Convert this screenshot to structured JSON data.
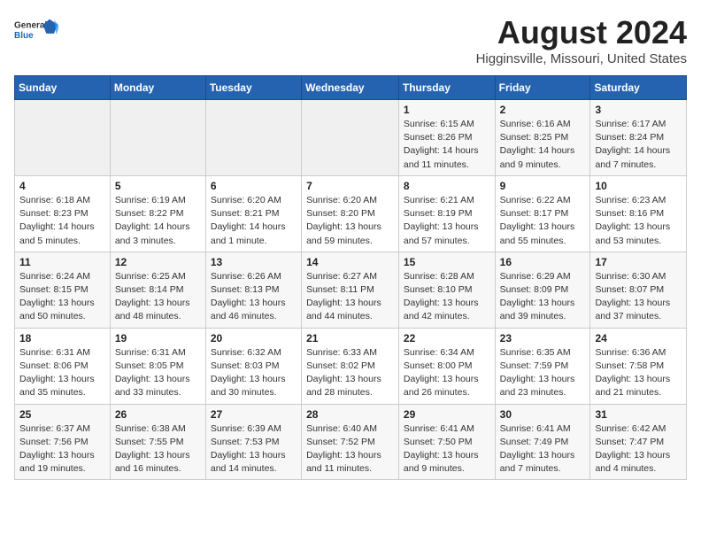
{
  "header": {
    "logo_general": "General",
    "logo_blue": "Blue",
    "month_title": "August 2024",
    "location": "Higginsville, Missouri, United States"
  },
  "weekdays": [
    "Sunday",
    "Monday",
    "Tuesday",
    "Wednesday",
    "Thursday",
    "Friday",
    "Saturday"
  ],
  "weeks": [
    [
      {
        "day": "",
        "info": ""
      },
      {
        "day": "",
        "info": ""
      },
      {
        "day": "",
        "info": ""
      },
      {
        "day": "",
        "info": ""
      },
      {
        "day": "1",
        "info": "Sunrise: 6:15 AM\nSunset: 8:26 PM\nDaylight: 14 hours\nand 11 minutes."
      },
      {
        "day": "2",
        "info": "Sunrise: 6:16 AM\nSunset: 8:25 PM\nDaylight: 14 hours\nand 9 minutes."
      },
      {
        "day": "3",
        "info": "Sunrise: 6:17 AM\nSunset: 8:24 PM\nDaylight: 14 hours\nand 7 minutes."
      }
    ],
    [
      {
        "day": "4",
        "info": "Sunrise: 6:18 AM\nSunset: 8:23 PM\nDaylight: 14 hours\nand 5 minutes."
      },
      {
        "day": "5",
        "info": "Sunrise: 6:19 AM\nSunset: 8:22 PM\nDaylight: 14 hours\nand 3 minutes."
      },
      {
        "day": "6",
        "info": "Sunrise: 6:20 AM\nSunset: 8:21 PM\nDaylight: 14 hours\nand 1 minute."
      },
      {
        "day": "7",
        "info": "Sunrise: 6:20 AM\nSunset: 8:20 PM\nDaylight: 13 hours\nand 59 minutes."
      },
      {
        "day": "8",
        "info": "Sunrise: 6:21 AM\nSunset: 8:19 PM\nDaylight: 13 hours\nand 57 minutes."
      },
      {
        "day": "9",
        "info": "Sunrise: 6:22 AM\nSunset: 8:17 PM\nDaylight: 13 hours\nand 55 minutes."
      },
      {
        "day": "10",
        "info": "Sunrise: 6:23 AM\nSunset: 8:16 PM\nDaylight: 13 hours\nand 53 minutes."
      }
    ],
    [
      {
        "day": "11",
        "info": "Sunrise: 6:24 AM\nSunset: 8:15 PM\nDaylight: 13 hours\nand 50 minutes."
      },
      {
        "day": "12",
        "info": "Sunrise: 6:25 AM\nSunset: 8:14 PM\nDaylight: 13 hours\nand 48 minutes."
      },
      {
        "day": "13",
        "info": "Sunrise: 6:26 AM\nSunset: 8:13 PM\nDaylight: 13 hours\nand 46 minutes."
      },
      {
        "day": "14",
        "info": "Sunrise: 6:27 AM\nSunset: 8:11 PM\nDaylight: 13 hours\nand 44 minutes."
      },
      {
        "day": "15",
        "info": "Sunrise: 6:28 AM\nSunset: 8:10 PM\nDaylight: 13 hours\nand 42 minutes."
      },
      {
        "day": "16",
        "info": "Sunrise: 6:29 AM\nSunset: 8:09 PM\nDaylight: 13 hours\nand 39 minutes."
      },
      {
        "day": "17",
        "info": "Sunrise: 6:30 AM\nSunset: 8:07 PM\nDaylight: 13 hours\nand 37 minutes."
      }
    ],
    [
      {
        "day": "18",
        "info": "Sunrise: 6:31 AM\nSunset: 8:06 PM\nDaylight: 13 hours\nand 35 minutes."
      },
      {
        "day": "19",
        "info": "Sunrise: 6:31 AM\nSunset: 8:05 PM\nDaylight: 13 hours\nand 33 minutes."
      },
      {
        "day": "20",
        "info": "Sunrise: 6:32 AM\nSunset: 8:03 PM\nDaylight: 13 hours\nand 30 minutes."
      },
      {
        "day": "21",
        "info": "Sunrise: 6:33 AM\nSunset: 8:02 PM\nDaylight: 13 hours\nand 28 minutes."
      },
      {
        "day": "22",
        "info": "Sunrise: 6:34 AM\nSunset: 8:00 PM\nDaylight: 13 hours\nand 26 minutes."
      },
      {
        "day": "23",
        "info": "Sunrise: 6:35 AM\nSunset: 7:59 PM\nDaylight: 13 hours\nand 23 minutes."
      },
      {
        "day": "24",
        "info": "Sunrise: 6:36 AM\nSunset: 7:58 PM\nDaylight: 13 hours\nand 21 minutes."
      }
    ],
    [
      {
        "day": "25",
        "info": "Sunrise: 6:37 AM\nSunset: 7:56 PM\nDaylight: 13 hours\nand 19 minutes."
      },
      {
        "day": "26",
        "info": "Sunrise: 6:38 AM\nSunset: 7:55 PM\nDaylight: 13 hours\nand 16 minutes."
      },
      {
        "day": "27",
        "info": "Sunrise: 6:39 AM\nSunset: 7:53 PM\nDaylight: 13 hours\nand 14 minutes."
      },
      {
        "day": "28",
        "info": "Sunrise: 6:40 AM\nSunset: 7:52 PM\nDaylight: 13 hours\nand 11 minutes."
      },
      {
        "day": "29",
        "info": "Sunrise: 6:41 AM\nSunset: 7:50 PM\nDaylight: 13 hours\nand 9 minutes."
      },
      {
        "day": "30",
        "info": "Sunrise: 6:41 AM\nSunset: 7:49 PM\nDaylight: 13 hours\nand 7 minutes."
      },
      {
        "day": "31",
        "info": "Sunrise: 6:42 AM\nSunset: 7:47 PM\nDaylight: 13 hours\nand 4 minutes."
      }
    ]
  ]
}
